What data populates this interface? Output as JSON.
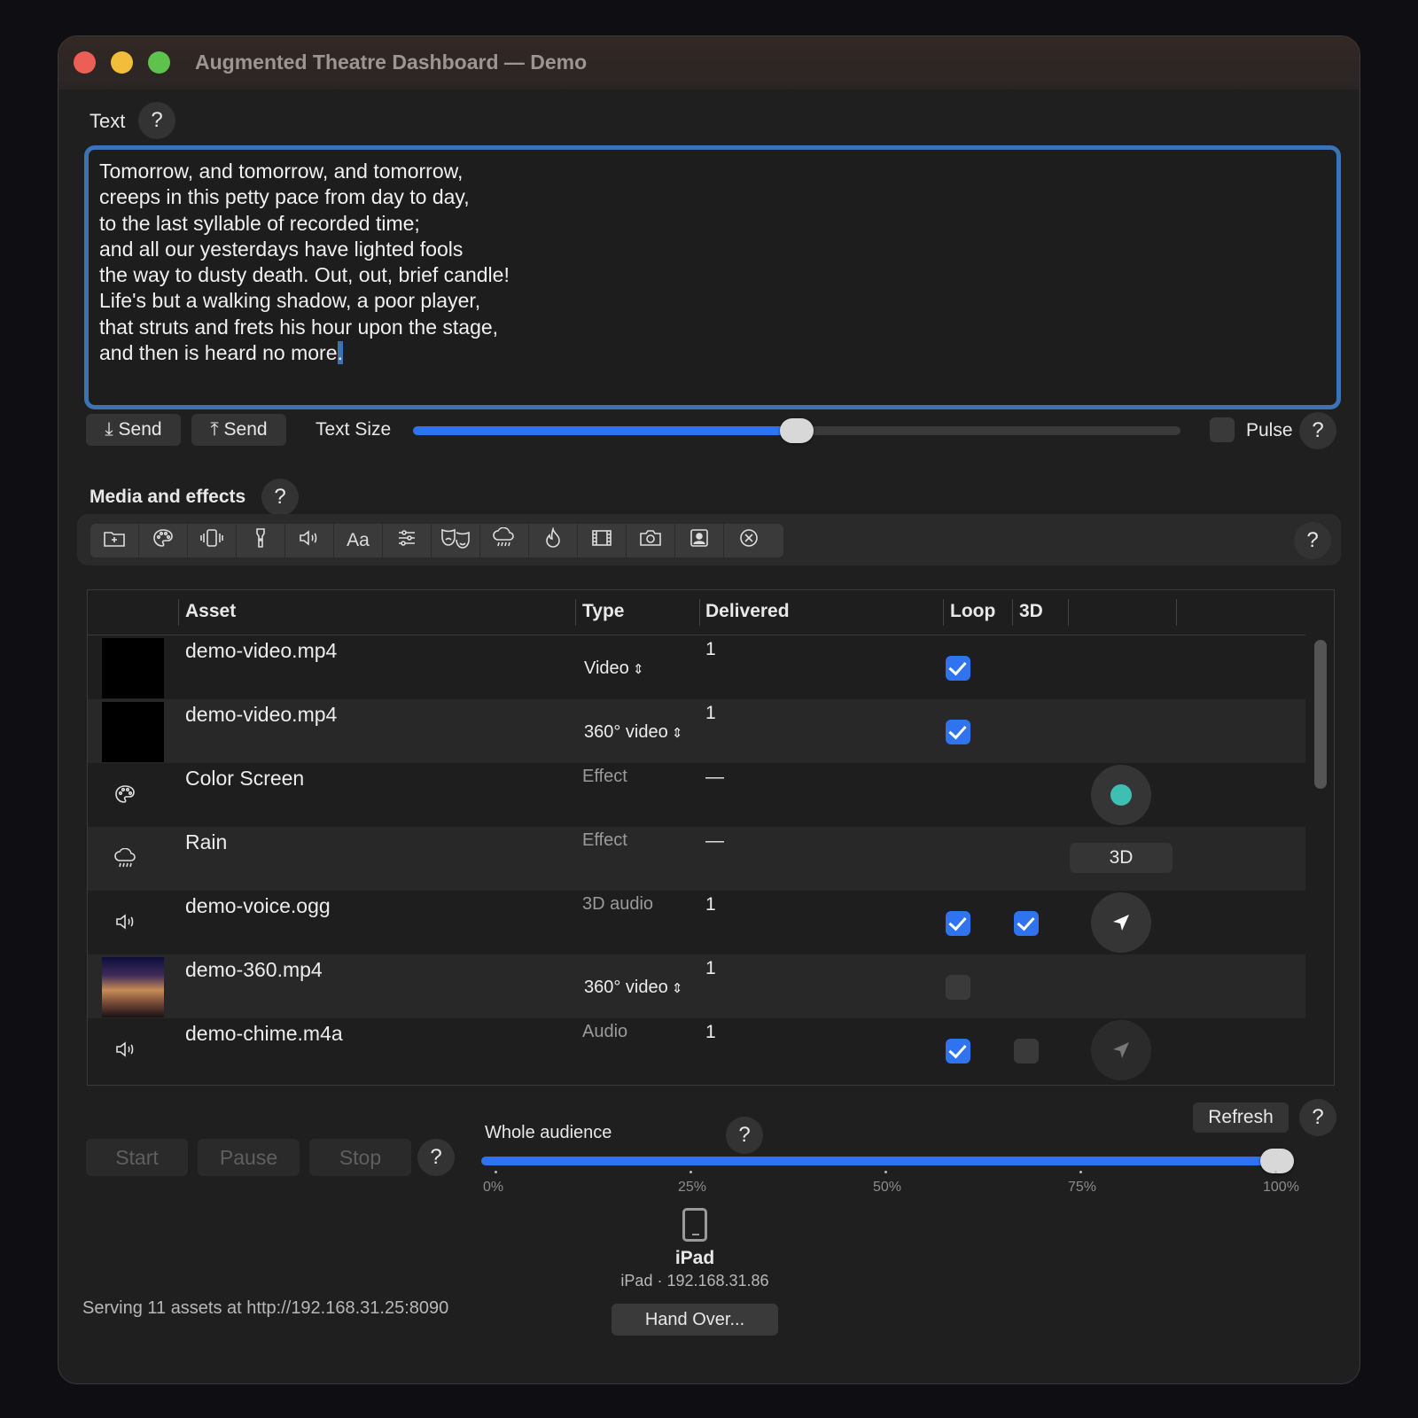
{
  "window": {
    "title": "Augmented Theatre Dashboard — Demo"
  },
  "text_section": {
    "label": "Text",
    "help": "?",
    "lines": [
      "Tomorrow, and tomorrow, and tomorrow,",
      "creeps in this petty pace from day to day,",
      "to the last syllable of recorded time;",
      "and all our yesterdays have lighted fools",
      "the way to dusty death. Out, out, brief candle!",
      "Life's but a walking shadow, a poor player,",
      "that struts and frets his hour upon the stage,",
      "and then is heard no more"
    ],
    "caret_char": ".",
    "send_down_label": "Send",
    "send_up_label": "Send",
    "text_size_label": "Text Size",
    "text_size_value": 0.5,
    "pulse_label": "Pulse",
    "pulse_checked": false
  },
  "media": {
    "label": "Media and effects",
    "help": "?",
    "toolbar_icons": [
      "add-folder-icon",
      "palette-icon",
      "vibrate-icon",
      "flashlight-icon",
      "speaker-icon",
      "font-icon",
      "sliders-icon",
      "theatre-masks-icon",
      "rain-icon",
      "flame-icon",
      "film-icon",
      "camera-icon",
      "portrait-icon",
      "cancel-icon"
    ],
    "toolbar_font_label": "Aa",
    "columns": {
      "asset": "Asset",
      "type": "Type",
      "delivered": "Delivered",
      "loop": "Loop",
      "threed": "3D"
    },
    "rows": [
      {
        "thumb": "black",
        "asset": "demo-video.mp4",
        "type": "Video",
        "type_popup": true,
        "delivered": "1",
        "loop": true,
        "threed": null,
        "extra": null
      },
      {
        "thumb": "black",
        "asset": "demo-video.mp4",
        "type": "360° video",
        "type_popup": true,
        "delivered": "1",
        "loop": true,
        "threed": null,
        "extra": null
      },
      {
        "thumb": "palette-icon",
        "asset": "Color Screen",
        "type": "Effect",
        "type_popup": false,
        "delivered": "—",
        "loop": null,
        "threed": null,
        "extra": "color"
      },
      {
        "thumb": "rain-icon",
        "asset": "Rain",
        "type": "Effect",
        "type_popup": false,
        "delivered": "—",
        "loop": null,
        "threed": null,
        "extra": "3d"
      },
      {
        "thumb": "speaker-icon",
        "asset": "demo-voice.ogg",
        "type": "3D audio",
        "type_popup": false,
        "delivered": "1",
        "loop": true,
        "threed": true,
        "extra": "locate"
      },
      {
        "thumb": "gradient",
        "asset": "demo-360.mp4",
        "type": "360° video",
        "type_popup": true,
        "delivered": "1",
        "loop": false,
        "threed": null,
        "extra": null
      },
      {
        "thumb": "speaker-icon",
        "asset": "demo-chime.m4a",
        "type": "Audio",
        "type_popup": false,
        "delivered": "1",
        "loop": true,
        "threed": false,
        "extra": "locate-dim"
      }
    ],
    "extra_3d_label": "3D",
    "color_swatch": "#3fbfb4",
    "refresh_label": "Refresh"
  },
  "transport": {
    "start_label": "Start",
    "pause_label": "Pause",
    "stop_label": "Stop",
    "audience_label": "Whole audience",
    "audience_value": 1.0,
    "ticks": [
      "0%",
      "25%",
      "50%",
      "75%",
      "100%"
    ]
  },
  "device": {
    "icon": "ipad-icon",
    "name": "iPad",
    "detail": "iPad · 192.168.31.86",
    "handover_label": "Hand Over..."
  },
  "status": {
    "text": "Serving 11 assets at http://192.168.31.25:8090"
  },
  "colors": {
    "accent": "#2f73f0",
    "focus_ring": "#3a74b4"
  }
}
